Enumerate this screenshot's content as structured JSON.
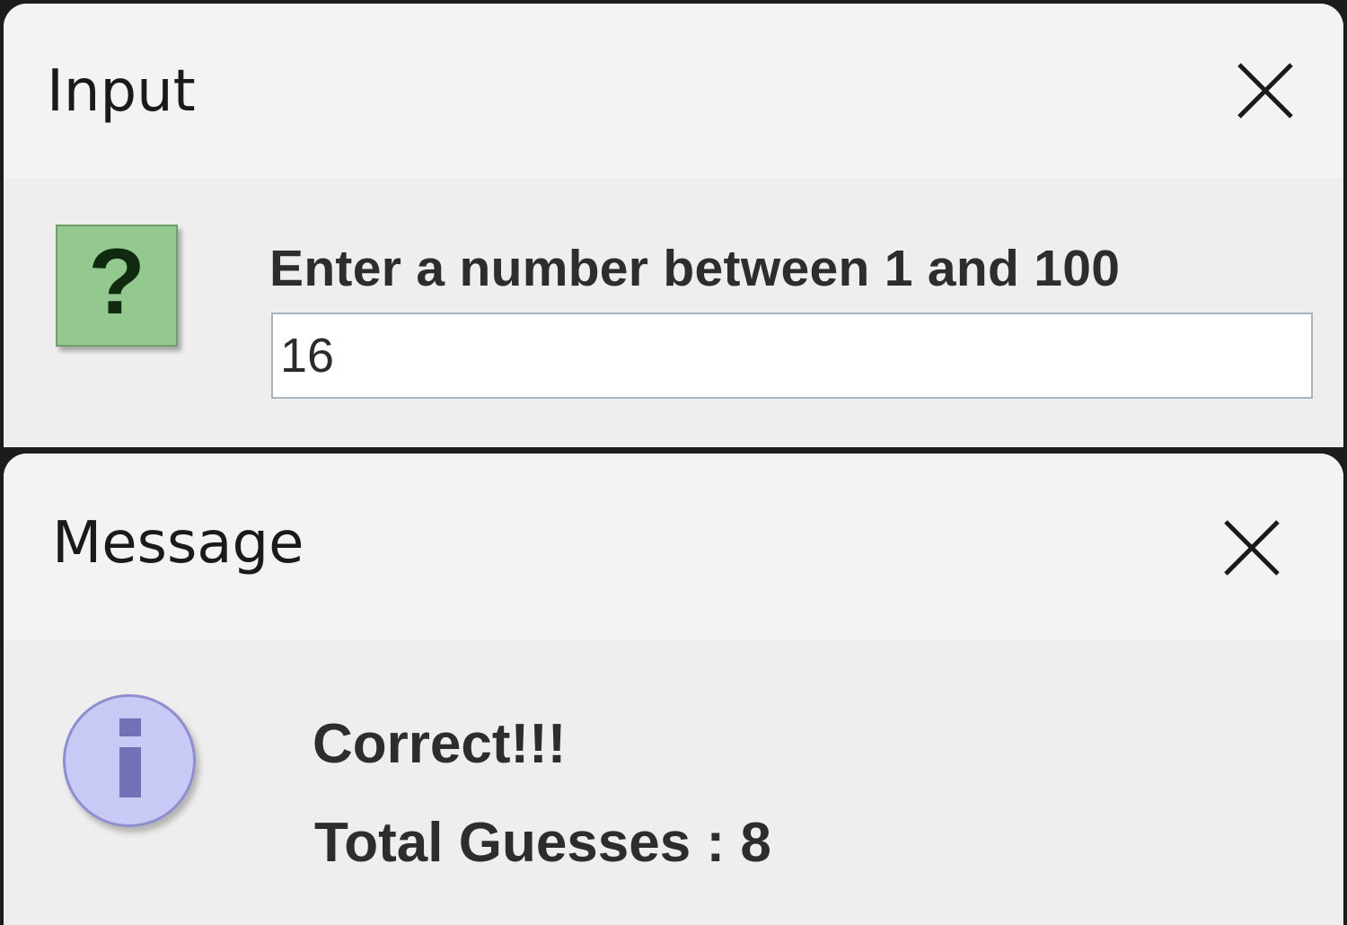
{
  "input_dialog": {
    "title": "Input",
    "prompt": "Enter a number between 1 and 100",
    "input_value": "16",
    "icon": "question-icon",
    "close_icon": "close-icon"
  },
  "message_dialog": {
    "title": "Message",
    "line1": "Correct!!!",
    "line2": "Total Guesses : 8",
    "icon": "information-icon",
    "close_icon": "close-icon"
  },
  "colors": {
    "dialog_background": "#f0f0f0",
    "question_icon_fill": "#93c98f",
    "info_icon_fill": "#c9c9f5"
  }
}
